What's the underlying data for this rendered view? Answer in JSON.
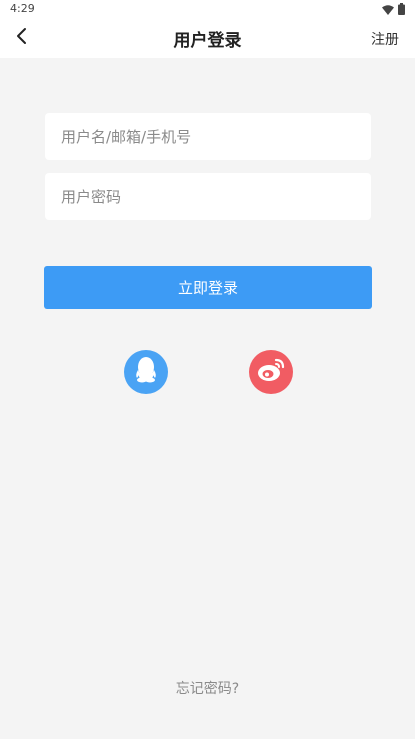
{
  "status_bar": {
    "time": "4:29",
    "icons": [
      "wifi-icon",
      "battery-icon"
    ]
  },
  "header": {
    "title": "用户登录",
    "register_label": "注册",
    "back_icon": "back-arrow-icon"
  },
  "form": {
    "username_placeholder": "用户名/邮箱/手机号",
    "username_value": "",
    "password_placeholder": "用户密码",
    "password_value": "",
    "login_label": "立即登录"
  },
  "social_login": [
    {
      "name": "qq-icon",
      "color": "#4aa3f4"
    },
    {
      "name": "weibo-icon",
      "color": "#f15c63"
    }
  ],
  "footer": {
    "forgot_label": "忘记密码?"
  },
  "colors": {
    "background": "#f4f4f4",
    "primary": "#3d9bf5",
    "qq": "#4aa3f4",
    "weibo": "#f15c63"
  }
}
